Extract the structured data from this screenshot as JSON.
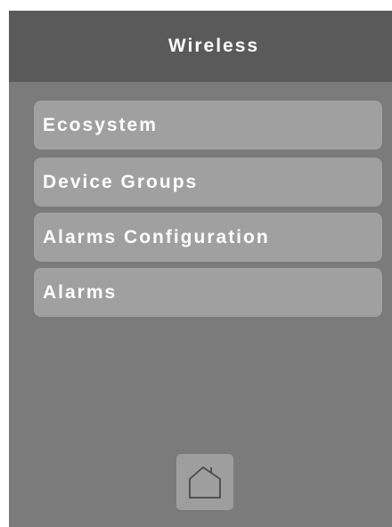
{
  "header": {
    "title": "Wireless"
  },
  "menu": {
    "items": [
      {
        "label": "Ecosystem"
      },
      {
        "label": "Device Groups"
      },
      {
        "label": "Alarms Configuration"
      },
      {
        "label": "Alarms"
      }
    ]
  },
  "footer": {
    "home_icon": "home-icon"
  },
  "colors": {
    "screen_background": "#7b7b7b",
    "titlebar_background": "#5a5a5a",
    "menu_item_background": "#a0a0a0",
    "text": "#ffffff"
  }
}
